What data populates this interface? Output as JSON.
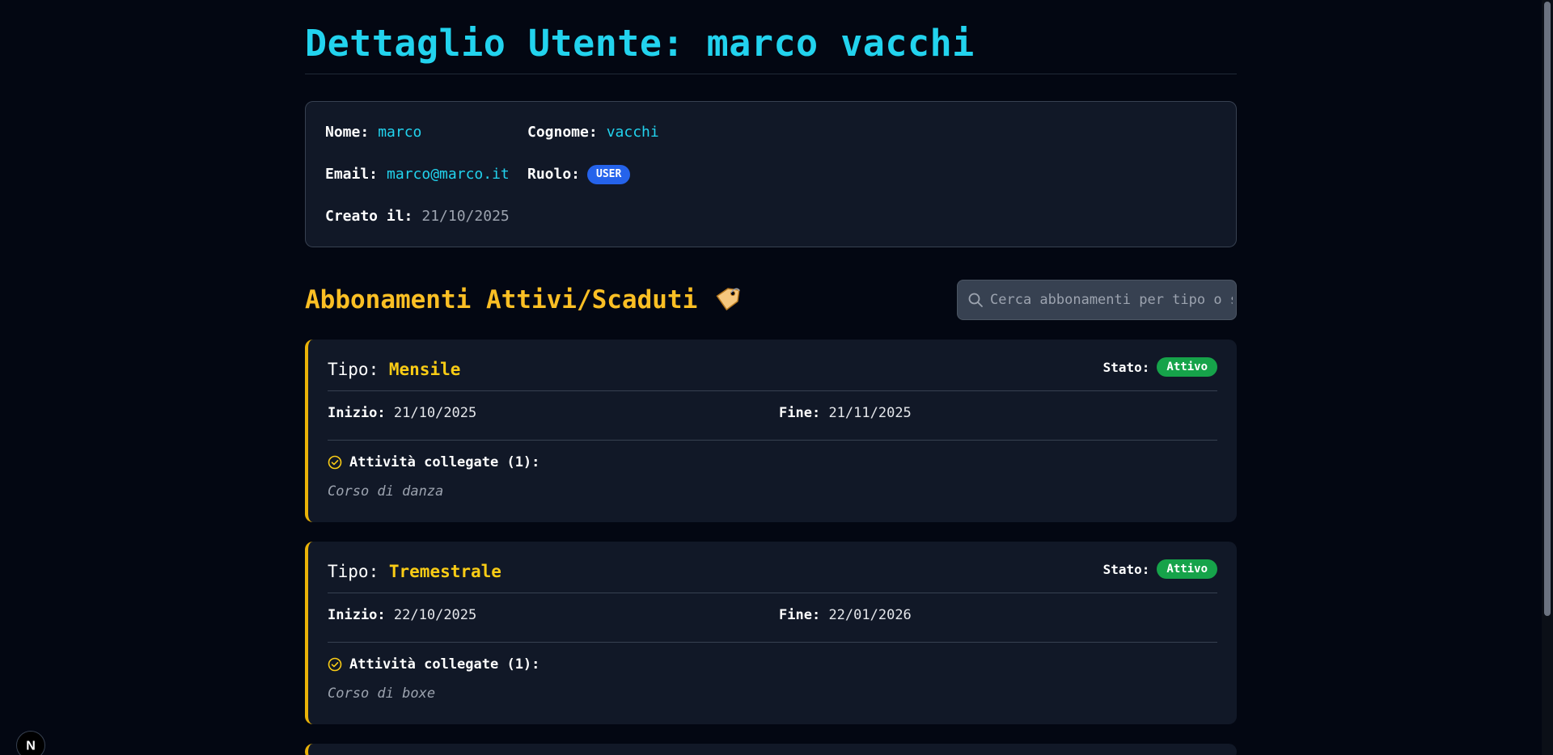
{
  "header": {
    "title": "Dettaglio Utente: marco vacchi"
  },
  "user": {
    "name_label": "Nome:",
    "name_value": "marco",
    "surname_label": "Cognome:",
    "surname_value": "vacchi",
    "email_label": "Email:",
    "email_value": "marco@marco.it",
    "role_label": "Ruolo:",
    "role_value": "USER",
    "created_label": "Creato il:",
    "created_value": "21/10/2025"
  },
  "subscriptions": {
    "title": "Abbonamenti Attivi/Scaduti",
    "title_icon": "tag-icon",
    "search_placeholder": "Cerca abbonamenti per tipo o stato...",
    "items": [
      {
        "type_label": "Tipo:",
        "type_value": "Mensile",
        "state_label": "Stato:",
        "state_value": "Attivo",
        "start_label": "Inizio:",
        "start_value": "21/10/2025",
        "end_label": "Fine:",
        "end_value": "21/11/2025",
        "linked_label": "Attività collegate (1):",
        "linked_items": [
          "Corso di danza"
        ]
      },
      {
        "type_label": "Tipo:",
        "type_value": "Tremestrale",
        "state_label": "Stato:",
        "state_value": "Attivo",
        "start_label": "Inizio:",
        "start_value": "22/10/2025",
        "end_label": "Fine:",
        "end_value": "22/01/2026",
        "linked_label": "Attività collegate (1):",
        "linked_items": [
          "Corso di boxe"
        ]
      }
    ]
  },
  "colors": {
    "background": "#030712",
    "accent_cyan": "#22d3ee",
    "accent_yellow": "#facc15",
    "badge_blue": "#2563eb",
    "badge_green": "#16a34a"
  },
  "dev_badge": {
    "letter": "N"
  }
}
